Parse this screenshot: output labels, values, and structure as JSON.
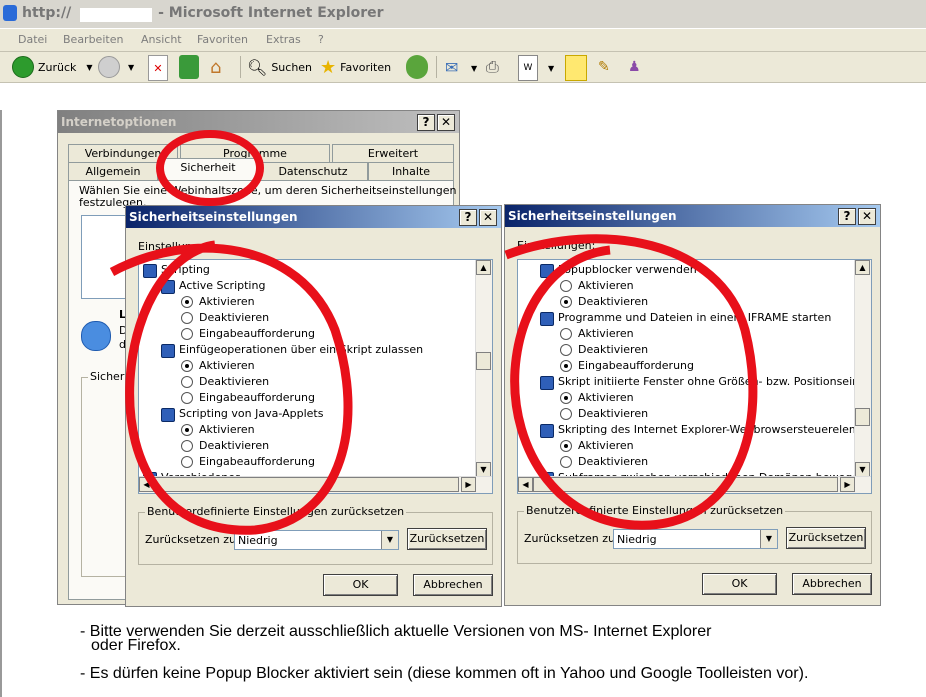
{
  "window": {
    "title": "http://",
    "title_suffix": " - Microsoft Internet Explorer"
  },
  "menu": [
    "Datei",
    "Bearbeiten",
    "Ansicht",
    "Favoriten",
    "Extras",
    "?"
  ],
  "toolbar": {
    "back_label": "Zurück",
    "search_label": "Suchen",
    "favorites_label": "Favoriten"
  },
  "internet_options": {
    "title": "Internetoptionen",
    "tabs_back": [
      "Verbindungen",
      "Programme",
      "Erweitert"
    ],
    "tabs_front": [
      "Allgemein",
      "Sicherheit",
      "Datenschutz",
      "Inhalte"
    ],
    "zone_text_1": "Wählen Sie eine Webinhaltszone, um deren Sicherheitseinstellungen",
    "zone_text_2": "festzulegen.",
    "partial_1": "Lo",
    "partial_2": "D",
    "partial_3": "d",
    "group_label": "Sicherh"
  },
  "dialog_left": {
    "title": "Sicherheitseinstellungen",
    "settings_label": "Einstellungen:",
    "items": [
      {
        "type": "section",
        "text": "Scripting"
      },
      {
        "type": "header",
        "text": "Active Scripting"
      },
      {
        "type": "option",
        "text": "Aktivieren",
        "on": true
      },
      {
        "type": "option",
        "text": "Deaktivieren",
        "on": false
      },
      {
        "type": "option",
        "text": "Eingabeaufforderung",
        "on": false
      },
      {
        "type": "header",
        "text": "Einfügeoperationen über ein Skript zulassen"
      },
      {
        "type": "option",
        "text": "Aktivieren",
        "on": true
      },
      {
        "type": "option",
        "text": "Deaktivieren",
        "on": false
      },
      {
        "type": "option",
        "text": "Eingabeaufforderung",
        "on": false
      },
      {
        "type": "header",
        "text": "Scripting von Java-Applets"
      },
      {
        "type": "option",
        "text": "Aktivieren",
        "on": true
      },
      {
        "type": "option",
        "text": "Deaktivieren",
        "on": false
      },
      {
        "type": "option",
        "text": "Eingabeaufforderung",
        "on": false
      },
      {
        "type": "section",
        "text": "Verschiedenes"
      }
    ],
    "reset_group": "Benutzerdefinierte Einstellungen zurücksetzen",
    "reset_to": "Zurücksetzen zu:",
    "reset_value": "Niedrig",
    "reset_button": "Zurücksetzen",
    "ok": "OK",
    "cancel": "Abbrechen"
  },
  "dialog_right": {
    "title": "Sicherheitseinstellungen",
    "settings_label": "Einstellungen:",
    "items": [
      {
        "type": "header",
        "text": "Popupblocker verwenden"
      },
      {
        "type": "option",
        "text": "Aktivieren",
        "on": false
      },
      {
        "type": "option",
        "text": "Deaktivieren",
        "on": true
      },
      {
        "type": "header",
        "text": "Programme und Dateien in einem IFRAME starten"
      },
      {
        "type": "option",
        "text": "Aktivieren",
        "on": false
      },
      {
        "type": "option",
        "text": "Deaktivieren",
        "on": false
      },
      {
        "type": "option",
        "text": "Eingabeaufforderung",
        "on": true
      },
      {
        "type": "header",
        "text": "Skript initiierte Fenster ohne Größen- bzw. Positionseinschrän"
      },
      {
        "type": "option",
        "text": "Aktivieren",
        "on": true
      },
      {
        "type": "option",
        "text": "Deaktivieren",
        "on": false
      },
      {
        "type": "header",
        "text": "Skripting des Internet Explorer-Webbrowsersteuerelements z"
      },
      {
        "type": "option",
        "text": "Aktivieren",
        "on": true
      },
      {
        "type": "option",
        "text": "Deaktivieren",
        "on": false
      },
      {
        "type": "header",
        "text": "Subframes zwischen verschiedenen Domänen bewegen"
      }
    ],
    "reset_group": "Benutzerdefinierte Einstellungen zurücksetzen",
    "reset_to": "Zurücksetzen zu:",
    "reset_value": "Niedrig",
    "reset_button": "Zurücksetzen",
    "ok": "OK",
    "cancel": "Abbrechen"
  },
  "notes": {
    "line1": "- Bitte verwenden Sie derzeit ausschließlich aktuelle Versionen von MS- Internet Explorer",
    "line1b": "oder Firefox.",
    "line2": "- Es dürfen keine Popup Blocker aktiviert sein (diese kommen oft in Yahoo und Google Toolleisten vor)."
  },
  "colors": {
    "annotation": "#e8101a",
    "title_active": "#0a246a"
  }
}
